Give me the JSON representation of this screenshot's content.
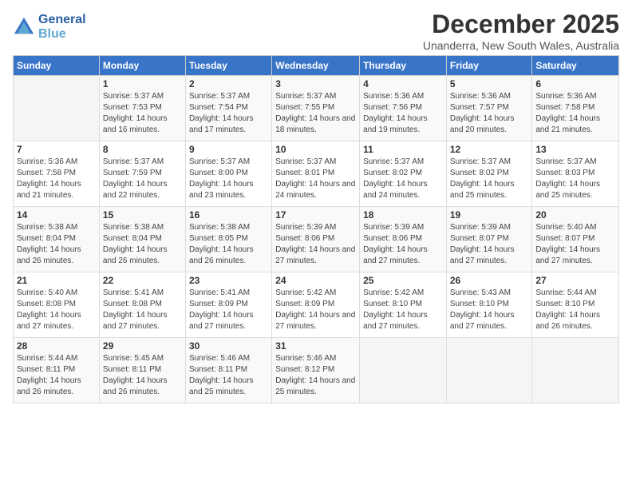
{
  "header": {
    "logo_line1": "General",
    "logo_line2": "Blue",
    "month_title": "December 2025",
    "location": "Unanderra, New South Wales, Australia"
  },
  "weekdays": [
    "Sunday",
    "Monday",
    "Tuesday",
    "Wednesday",
    "Thursday",
    "Friday",
    "Saturday"
  ],
  "weeks": [
    [
      {
        "day": "",
        "sunrise": "",
        "sunset": "",
        "daylight": ""
      },
      {
        "day": "1",
        "sunrise": "Sunrise: 5:37 AM",
        "sunset": "Sunset: 7:53 PM",
        "daylight": "Daylight: 14 hours and 16 minutes."
      },
      {
        "day": "2",
        "sunrise": "Sunrise: 5:37 AM",
        "sunset": "Sunset: 7:54 PM",
        "daylight": "Daylight: 14 hours and 17 minutes."
      },
      {
        "day": "3",
        "sunrise": "Sunrise: 5:37 AM",
        "sunset": "Sunset: 7:55 PM",
        "daylight": "Daylight: 14 hours and 18 minutes."
      },
      {
        "day": "4",
        "sunrise": "Sunrise: 5:36 AM",
        "sunset": "Sunset: 7:56 PM",
        "daylight": "Daylight: 14 hours and 19 minutes."
      },
      {
        "day": "5",
        "sunrise": "Sunrise: 5:36 AM",
        "sunset": "Sunset: 7:57 PM",
        "daylight": "Daylight: 14 hours and 20 minutes."
      },
      {
        "day": "6",
        "sunrise": "Sunrise: 5:36 AM",
        "sunset": "Sunset: 7:58 PM",
        "daylight": "Daylight: 14 hours and 21 minutes."
      }
    ],
    [
      {
        "day": "7",
        "sunrise": "Sunrise: 5:36 AM",
        "sunset": "Sunset: 7:58 PM",
        "daylight": "Daylight: 14 hours and 21 minutes."
      },
      {
        "day": "8",
        "sunrise": "Sunrise: 5:37 AM",
        "sunset": "Sunset: 7:59 PM",
        "daylight": "Daylight: 14 hours and 22 minutes."
      },
      {
        "day": "9",
        "sunrise": "Sunrise: 5:37 AM",
        "sunset": "Sunset: 8:00 PM",
        "daylight": "Daylight: 14 hours and 23 minutes."
      },
      {
        "day": "10",
        "sunrise": "Sunrise: 5:37 AM",
        "sunset": "Sunset: 8:01 PM",
        "daylight": "Daylight: 14 hours and 24 minutes."
      },
      {
        "day": "11",
        "sunrise": "Sunrise: 5:37 AM",
        "sunset": "Sunset: 8:02 PM",
        "daylight": "Daylight: 14 hours and 24 minutes."
      },
      {
        "day": "12",
        "sunrise": "Sunrise: 5:37 AM",
        "sunset": "Sunset: 8:02 PM",
        "daylight": "Daylight: 14 hours and 25 minutes."
      },
      {
        "day": "13",
        "sunrise": "Sunrise: 5:37 AM",
        "sunset": "Sunset: 8:03 PM",
        "daylight": "Daylight: 14 hours and 25 minutes."
      }
    ],
    [
      {
        "day": "14",
        "sunrise": "Sunrise: 5:38 AM",
        "sunset": "Sunset: 8:04 PM",
        "daylight": "Daylight: 14 hours and 26 minutes."
      },
      {
        "day": "15",
        "sunrise": "Sunrise: 5:38 AM",
        "sunset": "Sunset: 8:04 PM",
        "daylight": "Daylight: 14 hours and 26 minutes."
      },
      {
        "day": "16",
        "sunrise": "Sunrise: 5:38 AM",
        "sunset": "Sunset: 8:05 PM",
        "daylight": "Daylight: 14 hours and 26 minutes."
      },
      {
        "day": "17",
        "sunrise": "Sunrise: 5:39 AM",
        "sunset": "Sunset: 8:06 PM",
        "daylight": "Daylight: 14 hours and 27 minutes."
      },
      {
        "day": "18",
        "sunrise": "Sunrise: 5:39 AM",
        "sunset": "Sunset: 8:06 PM",
        "daylight": "Daylight: 14 hours and 27 minutes."
      },
      {
        "day": "19",
        "sunrise": "Sunrise: 5:39 AM",
        "sunset": "Sunset: 8:07 PM",
        "daylight": "Daylight: 14 hours and 27 minutes."
      },
      {
        "day": "20",
        "sunrise": "Sunrise: 5:40 AM",
        "sunset": "Sunset: 8:07 PM",
        "daylight": "Daylight: 14 hours and 27 minutes."
      }
    ],
    [
      {
        "day": "21",
        "sunrise": "Sunrise: 5:40 AM",
        "sunset": "Sunset: 8:08 PM",
        "daylight": "Daylight: 14 hours and 27 minutes."
      },
      {
        "day": "22",
        "sunrise": "Sunrise: 5:41 AM",
        "sunset": "Sunset: 8:08 PM",
        "daylight": "Daylight: 14 hours and 27 minutes."
      },
      {
        "day": "23",
        "sunrise": "Sunrise: 5:41 AM",
        "sunset": "Sunset: 8:09 PM",
        "daylight": "Daylight: 14 hours and 27 minutes."
      },
      {
        "day": "24",
        "sunrise": "Sunrise: 5:42 AM",
        "sunset": "Sunset: 8:09 PM",
        "daylight": "Daylight: 14 hours and 27 minutes."
      },
      {
        "day": "25",
        "sunrise": "Sunrise: 5:42 AM",
        "sunset": "Sunset: 8:10 PM",
        "daylight": "Daylight: 14 hours and 27 minutes."
      },
      {
        "day": "26",
        "sunrise": "Sunrise: 5:43 AM",
        "sunset": "Sunset: 8:10 PM",
        "daylight": "Daylight: 14 hours and 27 minutes."
      },
      {
        "day": "27",
        "sunrise": "Sunrise: 5:44 AM",
        "sunset": "Sunset: 8:10 PM",
        "daylight": "Daylight: 14 hours and 26 minutes."
      }
    ],
    [
      {
        "day": "28",
        "sunrise": "Sunrise: 5:44 AM",
        "sunset": "Sunset: 8:11 PM",
        "daylight": "Daylight: 14 hours and 26 minutes."
      },
      {
        "day": "29",
        "sunrise": "Sunrise: 5:45 AM",
        "sunset": "Sunset: 8:11 PM",
        "daylight": "Daylight: 14 hours and 26 minutes."
      },
      {
        "day": "30",
        "sunrise": "Sunrise: 5:46 AM",
        "sunset": "Sunset: 8:11 PM",
        "daylight": "Daylight: 14 hours and 25 minutes."
      },
      {
        "day": "31",
        "sunrise": "Sunrise: 5:46 AM",
        "sunset": "Sunset: 8:12 PM",
        "daylight": "Daylight: 14 hours and 25 minutes."
      },
      {
        "day": "",
        "sunrise": "",
        "sunset": "",
        "daylight": ""
      },
      {
        "day": "",
        "sunrise": "",
        "sunset": "",
        "daylight": ""
      },
      {
        "day": "",
        "sunrise": "",
        "sunset": "",
        "daylight": ""
      }
    ]
  ]
}
